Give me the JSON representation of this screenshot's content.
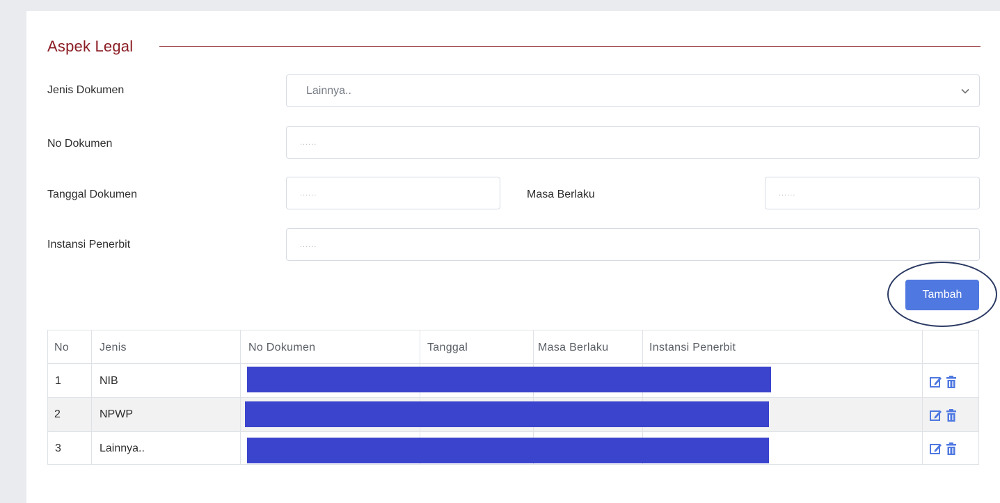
{
  "section": {
    "title": "Aspek Legal"
  },
  "form": {
    "jenis_dokumen_label": "Jenis Dokumen",
    "jenis_dokumen_value": "Lainnya..",
    "no_dokumen_label": "No Dokumen",
    "no_dokumen_placeholder": "......",
    "tanggal_dokumen_label": "Tanggal Dokumen",
    "tanggal_dokumen_placeholder": "......",
    "masa_berlaku_label": "Masa Berlaku",
    "masa_berlaku_placeholder": "......",
    "instansi_penerbit_label": "Instansi Penerbit",
    "instansi_penerbit_placeholder": "......",
    "add_button": "Tambah"
  },
  "table": {
    "headers": [
      "No",
      "Jenis",
      "No Dokumen",
      "Tanggal",
      "Masa Berlaku",
      "Instansi Penerbit",
      ""
    ],
    "rows": [
      {
        "no": "1",
        "jenis": "NIB"
      },
      {
        "no": "2",
        "jenis": "NPWP"
      },
      {
        "no": "3",
        "jenis": "Lainnya.."
      }
    ],
    "row_actions": [
      "edit-icon",
      "trash-icon"
    ]
  },
  "colors": {
    "accent": "#8b1c24",
    "button": "#4f78e0",
    "redaction": "#3b44cc",
    "icon": "#4f78e0"
  }
}
